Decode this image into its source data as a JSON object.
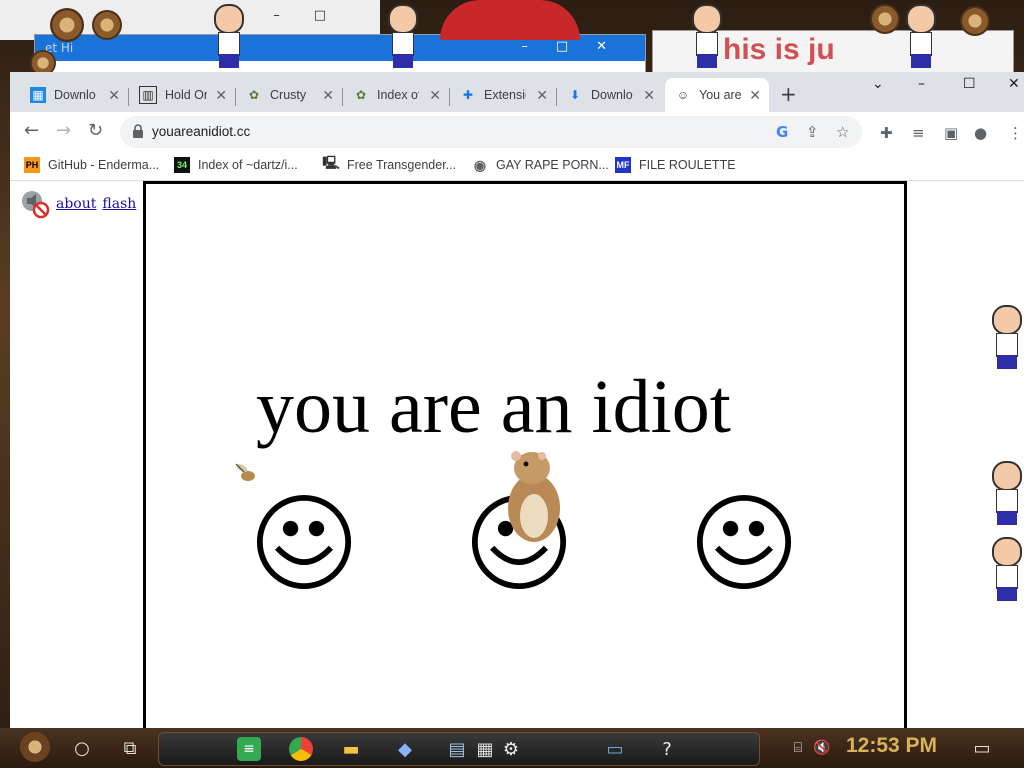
{
  "background": {
    "window_text": "his is ju",
    "partial_title": "et Hi"
  },
  "browser": {
    "tabs": [
      {
        "title": "Download",
        "icon": "chart-icon",
        "active": false
      },
      {
        "title": "Hold On",
        "icon": "building-icon",
        "active": false
      },
      {
        "title": "Crusty",
        "icon": "crusty-icon",
        "active": false
      },
      {
        "title": "Index of",
        "icon": "index-icon",
        "active": false
      },
      {
        "title": "Extensions",
        "icon": "puzzle-icon",
        "active": false
      },
      {
        "title": "Download",
        "icon": "download-icon",
        "active": false
      },
      {
        "title": "You are",
        "icon": "smiley-icon",
        "active": true
      }
    ],
    "url": "youareanidiot.cc",
    "bookmarks": [
      {
        "label": "GitHub - Enderma...",
        "icon": "ph-icon",
        "icon_text": "PH"
      },
      {
        "label": "Index of ~dartz/i...",
        "icon": "index-icon",
        "icon_text": "34"
      },
      {
        "label": "Free Transgender...",
        "icon": "computer-icon",
        "icon_text": ""
      },
      {
        "label": "GAY RAPE PORN...",
        "icon": "globe-icon",
        "icon_text": ""
      },
      {
        "label": "FILE ROULETTE",
        "icon": "mft-icon",
        "icon_text": "MF"
      }
    ]
  },
  "page": {
    "about_link": "about",
    "flash_link": "flash",
    "headline": "you are an idiot"
  },
  "taskbar": {
    "clock": "12:53 PM"
  },
  "colors": {
    "accent_blue": "#1a73d9",
    "link": "#1a0dab",
    "clock": "#d9b35a"
  }
}
